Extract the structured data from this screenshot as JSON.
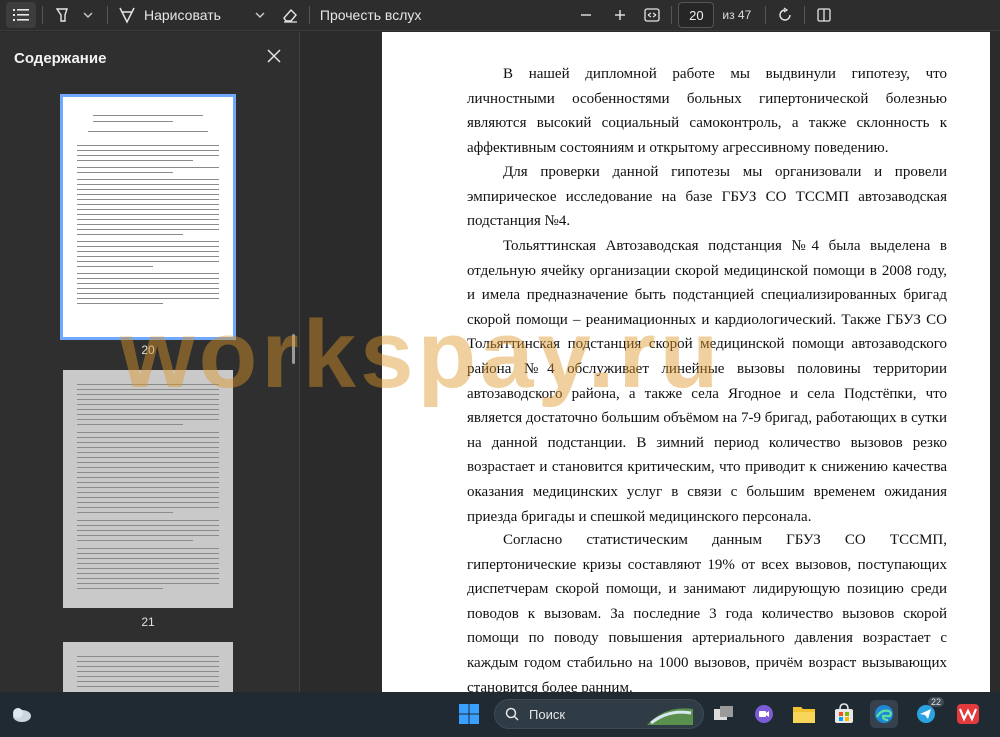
{
  "toolbar": {
    "draw_label": "Нарисовать",
    "read_aloud_label": "Прочесть вслух",
    "current_page": "20",
    "page_total": "из 47"
  },
  "sidebar": {
    "title": "Содержание",
    "thumbnails": [
      {
        "page": "20"
      },
      {
        "page": "21"
      }
    ]
  },
  "document": {
    "paragraphs": [
      "В нашей дипломной работе мы выдвинули гипотезу, что личностными особенностями больных гипертонической болезнью являются высокий социальный самоконтроль, а также склонность к аффективным состояниям и открытому агрессивному поведению.",
      "Для проверки данной гипотезы мы организовали и провели эмпирическое исследование на базе ГБУЗ СО ТССМП автозаводская подстанция №4.",
      "Тольяттинская Автозаводская подстанция №4 была выделена в отдельную ячейку организации скорой медицинской помощи в 2008 году, и имела предназначение быть подстанцией специализированных бригад скорой помощи – реанимационных и кардиологический. Также ГБУЗ СО Тольяттинская подстанция скорой медицинской помощи автозаводского района №4 обслуживает линейные вызовы половины территории автозаводского района, а также села Ягодное и села Подстёпки, что является достаточно большим объёмом на 7-9 бригад, работающих в сутки на данной подстанции. В зимний период количество вызовов резко возрастает и становится критическим, что приводит к снижению качества оказания медицинских услуг в связи с большим временем ожидания приезда бригады и спешкой медицинского персонала.",
      "Согласно статистическим данным ГБУЗ СО ТССМП, гипертонические кризы составляют 19% от всех вызовов, поступающих диспетчерам скорой помощи, и занимают лидирующую позицию среди поводов к вызовам. За последние 3 года количество вызовов скорой помощи по поводу повышения артериального давления возрастает с каждым годом стабильно на 1000 вызовов, причём возраст вызывающих становится более ранним."
    ]
  },
  "watermark": "workspay.ru",
  "taskbar": {
    "search_label": "Поиск",
    "telegram_badge": "22"
  },
  "colors": {
    "accent": "#6ea8ff",
    "watermark": "#dc9628"
  }
}
